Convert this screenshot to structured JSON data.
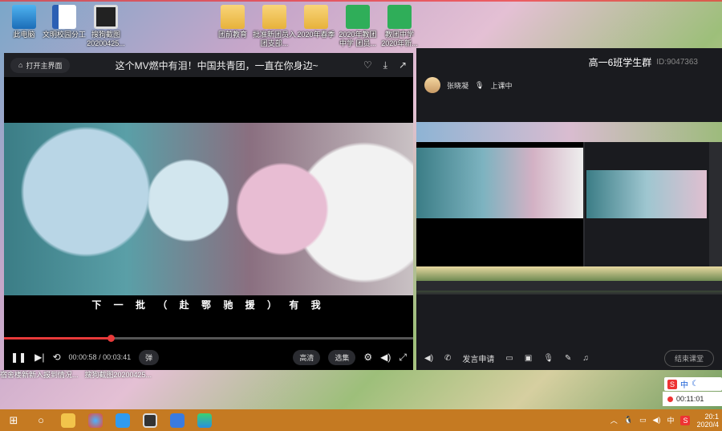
{
  "desktop": {
    "icons": [
      {
        "label": "此电脑"
      },
      {
        "label": "文明校园分工"
      },
      {
        "label": "搜狗截图20200425..."
      },
      {
        "label": "团前教育"
      },
      {
        "label": "批准新团员入团支部..."
      },
      {
        "label": "2020年春季"
      },
      {
        "label": "2020年教团中学 团员..."
      },
      {
        "label": "教团中学2020年新..."
      }
    ],
    "behind_labels": [
      "宿舍楼新新入报到情况...",
      "搜狗截图20200425..."
    ]
  },
  "player": {
    "home_label": "打开主界面",
    "title": "这个MV燃中有泪！中国共青团，一直在你身边~",
    "subtitle": "下 一 批 （ 赴 鄂 驰 援 ） 有 我",
    "progress": 0.26,
    "time": "00:00:58 / 00:03:41",
    "danmaku_label": "弹",
    "quality_label": "高清",
    "episodes_label": "选集"
  },
  "group": {
    "title": "高一6班学生群",
    "id": "ID:9047363",
    "user_name": "张晓凝",
    "status": "上课中",
    "speak_label": "发言申请",
    "end_label": "结束课堂"
  },
  "ime": {
    "label": "中"
  },
  "recording": {
    "time": "00:11:01"
  },
  "taskbar": {
    "tray_lang": "中",
    "clock_time": "20:1",
    "clock_date": "2020/4"
  }
}
